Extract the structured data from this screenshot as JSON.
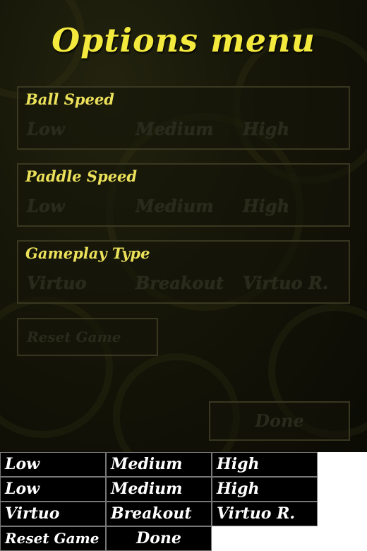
{
  "title": "Options menu",
  "ball_speed": {
    "label": "Ball Speed",
    "options": [
      "Low",
      "Medium",
      "High"
    ]
  },
  "paddle_speed": {
    "label": "Paddle Speed",
    "options": [
      "Low",
      "Medium",
      "High"
    ]
  },
  "gameplay_type": {
    "label": "Gameplay Type",
    "options": [
      "Virtuo",
      "Breakout",
      "Virtuo R."
    ]
  },
  "reset_button": "Reset Game",
  "done_button": "Done",
  "sprite_sheet": {
    "row1": [
      "Low",
      "Medium",
      "High"
    ],
    "row2": [
      "Low",
      "Medium",
      "High"
    ],
    "row3": [
      "Virtuo",
      "Breakout",
      "Virtuo R."
    ],
    "row4": [
      "Reset Game",
      "Done"
    ]
  },
  "colors": {
    "title": "#f4ea3e",
    "label": "#ece15a",
    "inactive": "#2a2a1c"
  }
}
